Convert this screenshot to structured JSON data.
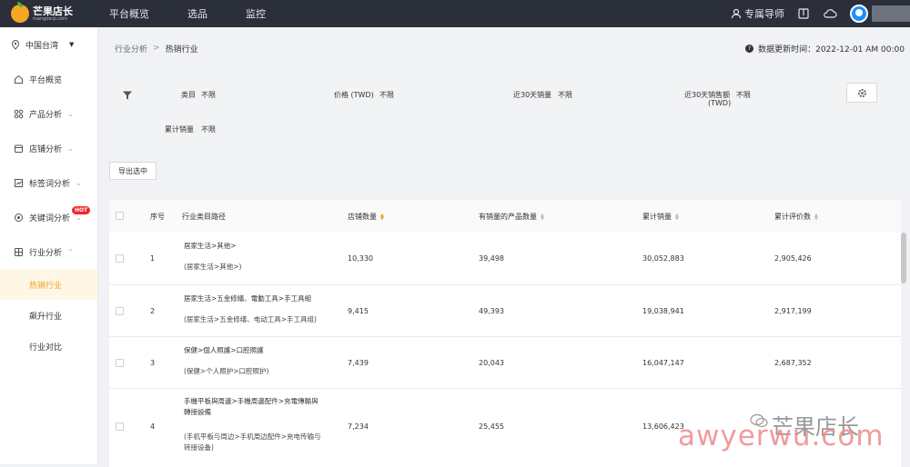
{
  "brand": {
    "name": "芒果店长",
    "domain": "mangoerp.com"
  },
  "topnav": [
    "平台概览",
    "选品",
    "监控"
  ],
  "top_right": {
    "mentor": "专属导师"
  },
  "sidebar": {
    "region": "中国台湾",
    "items": [
      {
        "label": "平台概览"
      },
      {
        "label": "产品分析"
      },
      {
        "label": "店铺分析"
      },
      {
        "label": "标签词分析"
      },
      {
        "label": "关键词分析",
        "badge": "HOT"
      },
      {
        "label": "行业分析"
      }
    ],
    "subitems": [
      "热销行业",
      "飙升行业",
      "行业对比"
    ]
  },
  "breadcrumb": {
    "parent": "行业分析",
    "sep": ">",
    "current": "热销行业"
  },
  "update_time": "数据更新时间：2022-12-01 AM 00:00",
  "filters": {
    "category_label": "类目",
    "category_value": "不限",
    "price_label": "价格 (TWD)",
    "price_value": "不限",
    "sales30_label": "近30天销量",
    "sales30_value": "不限",
    "revenue30_label": "近30天销售额",
    "revenue30_label2": "(TWD)",
    "revenue30_value": "不限",
    "total_sales_label": "累计销量",
    "total_sales_value": "不限"
  },
  "export_label": "导出选中",
  "table": {
    "headers": [
      "序号",
      "行业类目路径",
      "店铺数量",
      "有销量的产品数量",
      "累计销量",
      "累计评价数"
    ],
    "rows": [
      {
        "idx": "1",
        "path1": "居家生活>其他>",
        "path2": "(居家生活>其他>)",
        "shops": "10,330",
        "products": "39,498",
        "sales": "30,052,883",
        "reviews": "2,905,426"
      },
      {
        "idx": "2",
        "path1": "居家生活>五金修繕、電動工具>手工具組",
        "path2": "(居家生活>五金修缮、电动工具>手工具组)",
        "shops": "9,415",
        "products": "49,393",
        "sales": "19,038,941",
        "reviews": "2,917,199"
      },
      {
        "idx": "3",
        "path1": "保健>個人照護>口腔照護",
        "path2": "(保健>个人照护>口腔照护)",
        "shops": "7,439",
        "products": "20,043",
        "sales": "16,047,147",
        "reviews": "2,687,352"
      },
      {
        "idx": "4",
        "path1": "手機平板與周邊>手機周邊配件>充電傳輸與",
        "path1b": "轉接設備",
        "path2": "(手机平板与周边>手机周边配件>充电传输与",
        "path2b": "转接设备)",
        "shops": "7,234",
        "products": "25,455",
        "sales": "13,606,423",
        "reviews": ""
      }
    ]
  },
  "watermark": {
    "cn": "芒果店长",
    "en": "awyerwu.com"
  }
}
